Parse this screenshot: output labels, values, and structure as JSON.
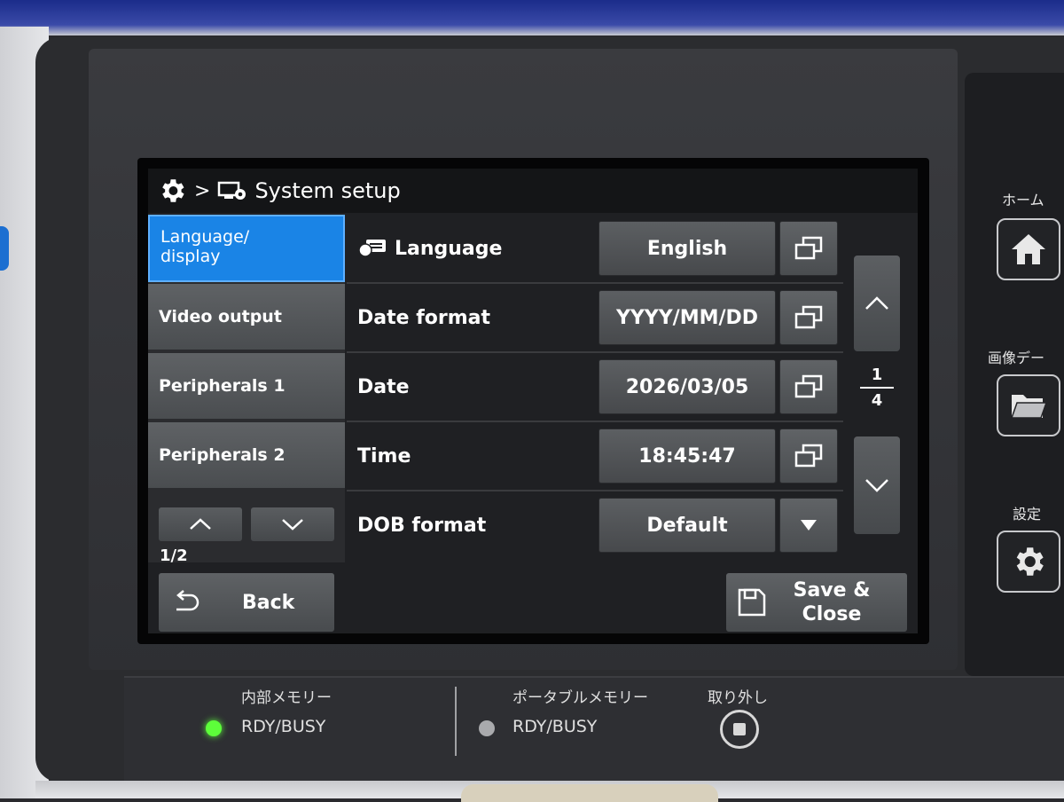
{
  "header": {
    "breadcrumb_sep": ">",
    "title": "System setup"
  },
  "menu": {
    "items": [
      {
        "label": "Language/\ndisplay",
        "active": true
      },
      {
        "label": "Video output"
      },
      {
        "label": "Peripherals 1"
      },
      {
        "label": "Peripherals 2"
      }
    ],
    "page": "1/2"
  },
  "settings": [
    {
      "label": "Language",
      "value": "English",
      "control": "popup"
    },
    {
      "label": "Date format",
      "value": "YYYY/MM/DD",
      "control": "popup"
    },
    {
      "label": "Date",
      "value": "2026/03/05",
      "control": "popup"
    },
    {
      "label": "Time",
      "value": "18:45:47",
      "control": "popup"
    },
    {
      "label": "DOB format",
      "value": "Default",
      "control": "dropdown"
    }
  ],
  "pager": {
    "current": "1",
    "total": "4"
  },
  "footer": {
    "back_label": "Back",
    "save_label": "Save &\nClose"
  },
  "hardware": {
    "home_label": "ホーム",
    "image_data_label": "画像デー",
    "settings_label": "設定",
    "internal_memory_label": "内部メモリー",
    "internal_status": "RDY/BUSY",
    "portable_memory_label": "ポータブルメモリー",
    "portable_status": "RDY/BUSY",
    "eject_label": "取り外し",
    "led_internal_color": "#5dff3a",
    "led_portable_color": "#a9aaad"
  }
}
